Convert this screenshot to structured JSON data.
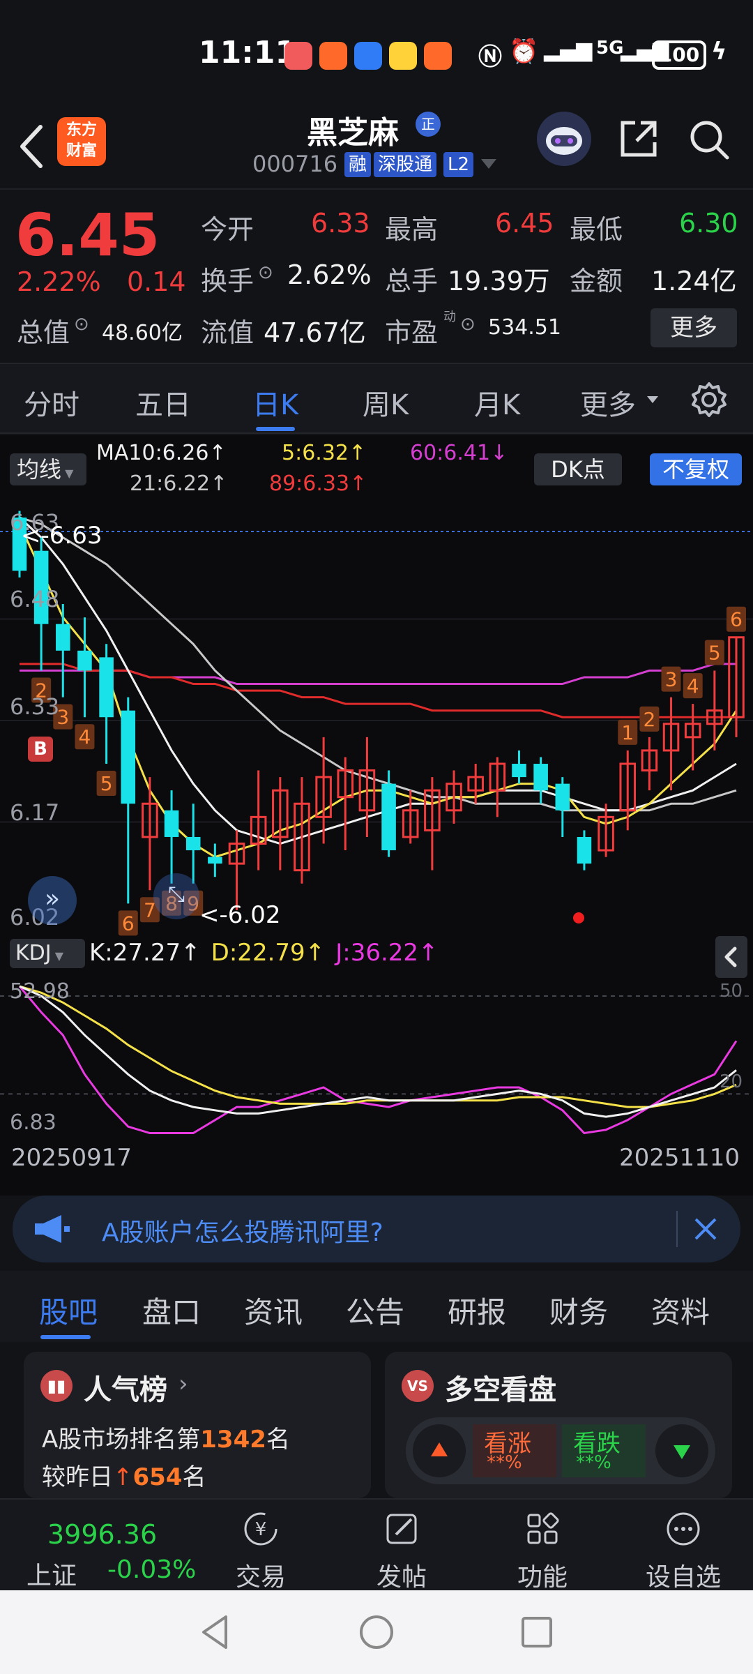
{
  "status_bar": {
    "time": "11:11",
    "network": "5G",
    "battery": "100"
  },
  "header": {
    "logo_text_line1": "东方",
    "logo_text_line2": "财富",
    "stock_name": "黑芝麻",
    "stock_badge": "正",
    "stock_code": "000716",
    "tags": [
      "融",
      "深股通",
      "L2"
    ]
  },
  "quote": {
    "price": "6.45",
    "change_pct": "2.22%",
    "change_abs": "0.14",
    "open_label": "今开",
    "open": "6.33",
    "high_label": "最高",
    "high": "6.45",
    "low_label": "最低",
    "low": "6.30",
    "turnover_label": "换手",
    "turnover": "2.62%",
    "volume_label": "总手",
    "volume": "19.39万",
    "amount_label": "金额",
    "amount": "1.24亿",
    "mktcap_label": "总值",
    "mktcap": "48.60亿",
    "float_label": "流值",
    "float_cap": "47.67亿",
    "pe_label": "市盈",
    "pe_super": "动",
    "pe": "534.51",
    "more_label": "更多"
  },
  "period_tabs": [
    "分时",
    "五日",
    "日K",
    "周K",
    "月K",
    "更多"
  ],
  "period_active": 2,
  "chart": {
    "ma_button": "均线",
    "ma10": "MA10:6.26↑",
    "ma5": "5:6.32↑",
    "ma60": "60:6.41↓",
    "ma21": "21:6.22↑",
    "ma89": "89:6.33↑",
    "dk_button": "DK点",
    "fq_button": "不复权",
    "y_labels": [
      "6.63",
      "6.48",
      "6.33",
      "6.17",
      "6.02"
    ],
    "high_mark": "<-6.63",
    "low_mark": "<-6.02",
    "b_marker": "B",
    "kdj_button": "KDJ",
    "kdj_k": "K:27.27↑",
    "kdj_d": "D:22.79↑",
    "kdj_j": "J:36.22↑",
    "kdj_y_top": "52.98",
    "kdj_y_bottom": "6.83",
    "kdj_y_50": "50",
    "kdj_y_20": "20",
    "date_start": "20250917",
    "date_end": "20251110",
    "colors": {
      "up": "#f03c3c",
      "down": "#19e2e8",
      "ma5": "#f4e14a",
      "ma10": "#f0f0f0",
      "ma21": "#c8c8c8",
      "ma60": "#d43fd0",
      "ma89": "#e02b2b"
    }
  },
  "chart_data": {
    "type": "candlestick",
    "ylim": [
      6.02,
      6.63
    ],
    "candles": [
      {
        "o": 6.63,
        "c": 6.55,
        "h": 6.64,
        "l": 6.54,
        "n": ""
      },
      {
        "o": 6.58,
        "c": 6.47,
        "h": 6.6,
        "l": 6.4,
        "n": "2"
      },
      {
        "o": 6.47,
        "c": 6.43,
        "h": 6.5,
        "l": 6.36,
        "n": "3"
      },
      {
        "o": 6.43,
        "c": 6.4,
        "h": 6.48,
        "l": 6.33,
        "n": "4"
      },
      {
        "o": 6.42,
        "c": 6.33,
        "h": 6.44,
        "l": 6.26,
        "n": "5"
      },
      {
        "o": 6.34,
        "c": 6.2,
        "h": 6.36,
        "l": 6.05,
        "n": "6"
      },
      {
        "o": 6.15,
        "c": 6.2,
        "h": 6.24,
        "l": 6.07,
        "n": "7"
      },
      {
        "o": 6.19,
        "c": 6.15,
        "h": 6.22,
        "l": 6.08,
        "n": "8"
      },
      {
        "o": 6.15,
        "c": 6.13,
        "h": 6.2,
        "l": 6.08,
        "n": "9"
      },
      {
        "o": 6.12,
        "c": 6.11,
        "h": 6.14,
        "l": 6.09,
        "n": ""
      },
      {
        "o": 6.11,
        "c": 6.14,
        "h": 6.16,
        "l": 6.04,
        "n": ""
      },
      {
        "o": 6.14,
        "c": 6.18,
        "h": 6.25,
        "l": 6.1,
        "n": ""
      },
      {
        "o": 6.15,
        "c": 6.22,
        "h": 6.24,
        "l": 6.1,
        "n": ""
      },
      {
        "o": 6.1,
        "c": 6.2,
        "h": 6.24,
        "l": 6.08,
        "n": ""
      },
      {
        "o": 6.18,
        "c": 6.24,
        "h": 6.3,
        "l": 6.14,
        "n": ""
      },
      {
        "o": 6.21,
        "c": 6.25,
        "h": 6.27,
        "l": 6.13,
        "n": ""
      },
      {
        "o": 6.19,
        "c": 6.25,
        "h": 6.3,
        "l": 6.15,
        "n": ""
      },
      {
        "o": 6.23,
        "c": 6.13,
        "h": 6.25,
        "l": 6.12,
        "n": ""
      },
      {
        "o": 6.15,
        "c": 6.19,
        "h": 6.22,
        "l": 6.14,
        "n": ""
      },
      {
        "o": 6.16,
        "c": 6.22,
        "h": 6.24,
        "l": 6.1,
        "n": ""
      },
      {
        "o": 6.19,
        "c": 6.23,
        "h": 6.25,
        "l": 6.17,
        "n": ""
      },
      {
        "o": 6.22,
        "c": 6.24,
        "h": 6.26,
        "l": 6.2,
        "n": ""
      },
      {
        "o": 6.22,
        "c": 6.26,
        "h": 6.27,
        "l": 6.18,
        "n": ""
      },
      {
        "o": 6.26,
        "c": 6.24,
        "h": 6.28,
        "l": 6.23,
        "n": ""
      },
      {
        "o": 6.26,
        "c": 6.22,
        "h": 6.27,
        "l": 6.2,
        "n": ""
      },
      {
        "o": 6.23,
        "c": 6.19,
        "h": 6.24,
        "l": 6.15,
        "n": ""
      },
      {
        "o": 6.15,
        "c": 6.11,
        "h": 6.16,
        "l": 6.1,
        "n": ""
      },
      {
        "o": 6.13,
        "c": 6.18,
        "h": 6.2,
        "l": 6.12,
        "n": ""
      },
      {
        "o": 6.19,
        "c": 6.26,
        "h": 6.28,
        "l": 6.16,
        "n": "1"
      },
      {
        "o": 6.25,
        "c": 6.28,
        "h": 6.3,
        "l": 6.22,
        "n": "2"
      },
      {
        "o": 6.28,
        "c": 6.32,
        "h": 6.36,
        "l": 6.22,
        "n": "3"
      },
      {
        "o": 6.3,
        "c": 6.32,
        "h": 6.35,
        "l": 6.25,
        "n": "4"
      },
      {
        "o": 6.32,
        "c": 6.34,
        "h": 6.4,
        "l": 6.28,
        "n": "5"
      },
      {
        "o": 6.33,
        "c": 6.45,
        "h": 6.45,
        "l": 6.3,
        "n": "6"
      }
    ],
    "ma5": [
      6.62,
      6.55,
      6.48,
      6.44,
      6.4,
      6.3,
      6.22,
      6.17,
      6.14,
      6.12,
      6.13,
      6.14,
      6.16,
      6.17,
      6.19,
      6.21,
      6.22,
      6.22,
      6.21,
      6.2,
      6.21,
      6.21,
      6.22,
      6.23,
      6.23,
      6.22,
      6.18,
      6.17,
      6.18,
      6.2,
      6.23,
      6.26,
      6.29,
      6.34
    ],
    "ma10": [
      6.63,
      6.6,
      6.56,
      6.51,
      6.46,
      6.4,
      6.34,
      6.28,
      6.23,
      6.19,
      6.16,
      6.15,
      6.14,
      6.15,
      6.16,
      6.17,
      6.18,
      6.19,
      6.2,
      6.2,
      6.21,
      6.21,
      6.22,
      6.22,
      6.22,
      6.21,
      6.2,
      6.19,
      6.19,
      6.2,
      6.21,
      6.22,
      6.24,
      6.26
    ],
    "ma21": [
      6.63,
      6.62,
      6.6,
      6.58,
      6.56,
      6.53,
      6.5,
      6.47,
      6.44,
      6.4,
      6.37,
      6.34,
      6.31,
      6.29,
      6.27,
      6.25,
      6.24,
      6.23,
      6.22,
      6.21,
      6.21,
      6.2,
      6.2,
      6.2,
      6.2,
      6.19,
      6.19,
      6.19,
      6.19,
      6.19,
      6.2,
      6.2,
      6.21,
      6.22
    ],
    "ma60": [
      6.4,
      6.4,
      6.4,
      6.4,
      6.4,
      6.4,
      6.39,
      6.39,
      6.39,
      6.39,
      6.38,
      6.38,
      6.38,
      6.38,
      6.38,
      6.38,
      6.38,
      6.38,
      6.38,
      6.38,
      6.38,
      6.38,
      6.38,
      6.38,
      6.38,
      6.38,
      6.39,
      6.39,
      6.39,
      6.4,
      6.4,
      6.4,
      6.41,
      6.41
    ],
    "ma89": [
      6.41,
      6.41,
      6.41,
      6.4,
      6.4,
      6.4,
      6.39,
      6.39,
      6.38,
      6.38,
      6.37,
      6.37,
      6.37,
      6.36,
      6.36,
      6.35,
      6.35,
      6.35,
      6.35,
      6.34,
      6.34,
      6.34,
      6.34,
      6.34,
      6.34,
      6.33,
      6.33,
      6.33,
      6.33,
      6.33,
      6.33,
      6.33,
      6.33,
      6.33
    ],
    "kdj_ylim": [
      6.83,
      52.98
    ],
    "kdj_k": [
      53,
      50,
      45,
      38,
      32,
      26,
      21,
      18,
      16,
      15,
      14,
      14,
      15,
      16,
      17,
      18,
      19,
      18,
      18,
      18,
      18,
      19,
      20,
      21,
      20,
      18,
      14,
      13,
      14,
      16,
      18,
      20,
      22,
      27.27
    ],
    "kdj_d": [
      53,
      51,
      48,
      44,
      40,
      35,
      31,
      27,
      24,
      21,
      19,
      18,
      17,
      17,
      17,
      17,
      18,
      18,
      18,
      18,
      18,
      18,
      18,
      19,
      19,
      19,
      18,
      17,
      16,
      16,
      17,
      18,
      20,
      22.79
    ],
    "kdj_j": [
      53,
      45,
      38,
      26,
      17,
      10,
      8,
      8,
      8,
      12,
      16,
      16,
      18,
      20,
      22,
      18,
      17,
      16,
      18,
      19,
      20,
      21,
      22,
      22,
      19,
      15,
      8,
      9,
      12,
      16,
      20,
      23,
      26,
      36.22
    ]
  },
  "ad_banner": {
    "text": "A股账户怎么投腾讯阿里?"
  },
  "section_tabs": [
    "股吧",
    "盘口",
    "资讯",
    "公告",
    "研报",
    "财务",
    "资料"
  ],
  "section_active": 0,
  "card_popularity": {
    "title": "人气榜",
    "rank_prefix": "A股市场排名第",
    "rank": "1342",
    "rank_suffix": "名",
    "change_prefix": "较昨日",
    "change": "654",
    "change_suffix": "名"
  },
  "card_longshort": {
    "title": "多空看盘",
    "icon_text": "VS",
    "bull_label": "看涨",
    "bull_value": "**%",
    "bear_label": "看跌",
    "bear_value": "**%"
  },
  "bottom_nav": {
    "index_value": "3996.36",
    "index_name": "上证",
    "index_change": "-0.03%",
    "items": [
      "交易",
      "发帖",
      "功能",
      "设自选"
    ]
  }
}
